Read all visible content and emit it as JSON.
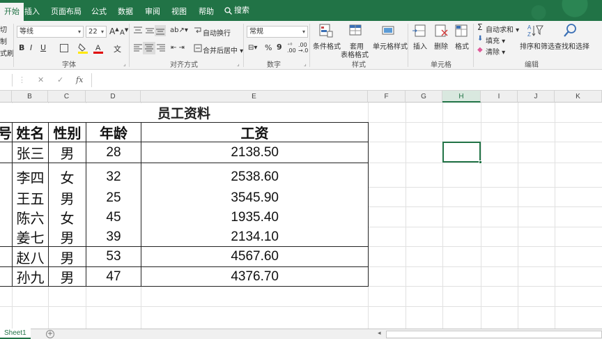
{
  "ribbon_tabs": [
    {
      "label": "开始",
      "active": true
    },
    {
      "label": "插入"
    },
    {
      "label": "页面布局"
    },
    {
      "label": "公式"
    },
    {
      "label": "数据"
    },
    {
      "label": "审阅"
    },
    {
      "label": "视图"
    },
    {
      "label": "帮助"
    },
    {
      "label": "搜索"
    }
  ],
  "clipboard": {
    "cut": "切",
    "copy": "制",
    "format_painter": "式刷"
  },
  "font": {
    "name": "等线",
    "size": "22",
    "grow": "A",
    "shrink": "A",
    "bold": "B",
    "italic": "I",
    "underline": "U",
    "change_case": "文",
    "group_label": "字体"
  },
  "alignment": {
    "wrap_text": "自动换行",
    "merge_center": "合并后居中",
    "group_label": "对齐方式"
  },
  "number": {
    "format": "常规",
    "percent": "%",
    "comma": "9",
    "group_label": "数字"
  },
  "styles": {
    "conditional": "条件格式",
    "table_format_1": "套用",
    "table_format_2": "表格格式",
    "cell_styles": "单元格样式",
    "group_label": "样式"
  },
  "cells": {
    "insert": "插入",
    "delete": "删除",
    "format": "格式",
    "group_label": "单元格"
  },
  "editing": {
    "autosum": "自动求和",
    "fill": "填充",
    "clear": "清除",
    "sort_filter": "排序和筛选",
    "find_select": "查找和选择",
    "group_label": "编辑"
  },
  "formula_bar": {
    "cancel": "✕",
    "enter": "✓",
    "fx": "fx",
    "value": ""
  },
  "columns": [
    "B",
    "C",
    "D",
    "E",
    "F",
    "G",
    "H",
    "I",
    "J",
    "K"
  ],
  "selected_column": "H",
  "sheet": {
    "title": "员工资料",
    "headers": {
      "id_fragment": "号",
      "name": "姓名",
      "gender": "性别",
      "age": "年龄",
      "salary": "工资"
    },
    "rows": [
      {
        "name": "张三",
        "gender": "男",
        "age": "28",
        "salary": "2138.50"
      },
      {
        "name": "李四",
        "gender": "女",
        "age": "32",
        "salary": "2538.60"
      },
      {
        "name": "王五",
        "gender": "男",
        "age": "25",
        "salary": "3545.90"
      },
      {
        "name": "陈六",
        "gender": "女",
        "age": "45",
        "salary": "1935.40"
      },
      {
        "name": "姜七",
        "gender": "男",
        "age": "39",
        "salary": "2134.10"
      },
      {
        "name": "赵八",
        "gender": "男",
        "age": "53",
        "salary": "4567.60"
      },
      {
        "name": "孙九",
        "gender": "男",
        "age": "47",
        "salary": "4376.70"
      }
    ]
  },
  "sheet_tabs": [
    {
      "label": "Sheet1",
      "active": true
    }
  ],
  "add_sheet": "+",
  "colors": {
    "accent": "#217346",
    "ribbon_bg": "#f3f3f3",
    "grid_line": "#e1e1e1"
  }
}
